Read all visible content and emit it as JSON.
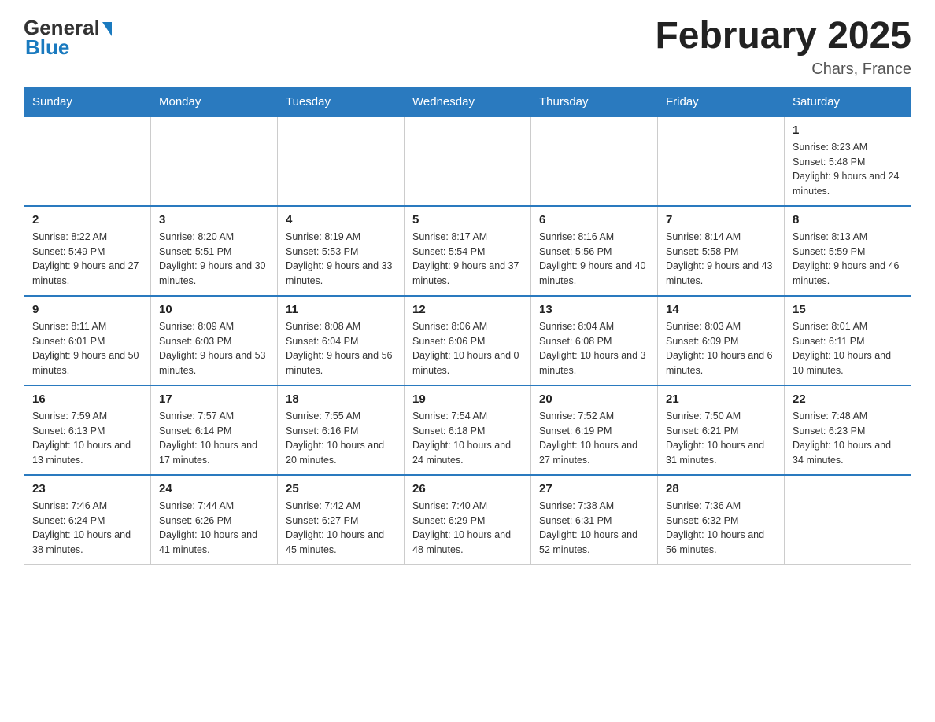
{
  "logo": {
    "general": "General",
    "blue": "Blue"
  },
  "header": {
    "title": "February 2025",
    "location": "Chars, France"
  },
  "weekdays": [
    "Sunday",
    "Monday",
    "Tuesday",
    "Wednesday",
    "Thursday",
    "Friday",
    "Saturday"
  ],
  "weeks": [
    [
      {
        "day": "",
        "info": ""
      },
      {
        "day": "",
        "info": ""
      },
      {
        "day": "",
        "info": ""
      },
      {
        "day": "",
        "info": ""
      },
      {
        "day": "",
        "info": ""
      },
      {
        "day": "",
        "info": ""
      },
      {
        "day": "1",
        "info": "Sunrise: 8:23 AM\nSunset: 5:48 PM\nDaylight: 9 hours and 24 minutes."
      }
    ],
    [
      {
        "day": "2",
        "info": "Sunrise: 8:22 AM\nSunset: 5:49 PM\nDaylight: 9 hours and 27 minutes."
      },
      {
        "day": "3",
        "info": "Sunrise: 8:20 AM\nSunset: 5:51 PM\nDaylight: 9 hours and 30 minutes."
      },
      {
        "day": "4",
        "info": "Sunrise: 8:19 AM\nSunset: 5:53 PM\nDaylight: 9 hours and 33 minutes."
      },
      {
        "day": "5",
        "info": "Sunrise: 8:17 AM\nSunset: 5:54 PM\nDaylight: 9 hours and 37 minutes."
      },
      {
        "day": "6",
        "info": "Sunrise: 8:16 AM\nSunset: 5:56 PM\nDaylight: 9 hours and 40 minutes."
      },
      {
        "day": "7",
        "info": "Sunrise: 8:14 AM\nSunset: 5:58 PM\nDaylight: 9 hours and 43 minutes."
      },
      {
        "day": "8",
        "info": "Sunrise: 8:13 AM\nSunset: 5:59 PM\nDaylight: 9 hours and 46 minutes."
      }
    ],
    [
      {
        "day": "9",
        "info": "Sunrise: 8:11 AM\nSunset: 6:01 PM\nDaylight: 9 hours and 50 minutes."
      },
      {
        "day": "10",
        "info": "Sunrise: 8:09 AM\nSunset: 6:03 PM\nDaylight: 9 hours and 53 minutes."
      },
      {
        "day": "11",
        "info": "Sunrise: 8:08 AM\nSunset: 6:04 PM\nDaylight: 9 hours and 56 minutes."
      },
      {
        "day": "12",
        "info": "Sunrise: 8:06 AM\nSunset: 6:06 PM\nDaylight: 10 hours and 0 minutes."
      },
      {
        "day": "13",
        "info": "Sunrise: 8:04 AM\nSunset: 6:08 PM\nDaylight: 10 hours and 3 minutes."
      },
      {
        "day": "14",
        "info": "Sunrise: 8:03 AM\nSunset: 6:09 PM\nDaylight: 10 hours and 6 minutes."
      },
      {
        "day": "15",
        "info": "Sunrise: 8:01 AM\nSunset: 6:11 PM\nDaylight: 10 hours and 10 minutes."
      }
    ],
    [
      {
        "day": "16",
        "info": "Sunrise: 7:59 AM\nSunset: 6:13 PM\nDaylight: 10 hours and 13 minutes."
      },
      {
        "day": "17",
        "info": "Sunrise: 7:57 AM\nSunset: 6:14 PM\nDaylight: 10 hours and 17 minutes."
      },
      {
        "day": "18",
        "info": "Sunrise: 7:55 AM\nSunset: 6:16 PM\nDaylight: 10 hours and 20 minutes."
      },
      {
        "day": "19",
        "info": "Sunrise: 7:54 AM\nSunset: 6:18 PM\nDaylight: 10 hours and 24 minutes."
      },
      {
        "day": "20",
        "info": "Sunrise: 7:52 AM\nSunset: 6:19 PM\nDaylight: 10 hours and 27 minutes."
      },
      {
        "day": "21",
        "info": "Sunrise: 7:50 AM\nSunset: 6:21 PM\nDaylight: 10 hours and 31 minutes."
      },
      {
        "day": "22",
        "info": "Sunrise: 7:48 AM\nSunset: 6:23 PM\nDaylight: 10 hours and 34 minutes."
      }
    ],
    [
      {
        "day": "23",
        "info": "Sunrise: 7:46 AM\nSunset: 6:24 PM\nDaylight: 10 hours and 38 minutes."
      },
      {
        "day": "24",
        "info": "Sunrise: 7:44 AM\nSunset: 6:26 PM\nDaylight: 10 hours and 41 minutes."
      },
      {
        "day": "25",
        "info": "Sunrise: 7:42 AM\nSunset: 6:27 PM\nDaylight: 10 hours and 45 minutes."
      },
      {
        "day": "26",
        "info": "Sunrise: 7:40 AM\nSunset: 6:29 PM\nDaylight: 10 hours and 48 minutes."
      },
      {
        "day": "27",
        "info": "Sunrise: 7:38 AM\nSunset: 6:31 PM\nDaylight: 10 hours and 52 minutes."
      },
      {
        "day": "28",
        "info": "Sunrise: 7:36 AM\nSunset: 6:32 PM\nDaylight: 10 hours and 56 minutes."
      },
      {
        "day": "",
        "info": ""
      }
    ]
  ]
}
